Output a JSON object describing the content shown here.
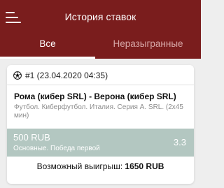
{
  "header": {
    "title": "История ставок",
    "menu_icon": "menu-icon"
  },
  "tabs": [
    {
      "label": "Все",
      "active": true
    },
    {
      "label": "Неразыгранные",
      "active": false
    }
  ],
  "bet": {
    "sport_icon": "soccer-ball-icon",
    "id_line": "#1 (23.04.2020 04:35)",
    "event": "Рома (кибер SRL) - Верона (кибер SRL)",
    "league": "Футбол. Киберфутбол. Италия. Серия А. SRL. (2х45 мин)",
    "stake": "500 RUB",
    "outcome": "Основные. Победа первой",
    "coefficient": "3.3",
    "win_label": "Возможный выигрыш:",
    "win_amount": "1650 RUB"
  },
  "colors": {
    "header_bg": "#7a1d1d",
    "stake_bg": "#b3c7c1",
    "page_bg": "#eeeeee"
  }
}
